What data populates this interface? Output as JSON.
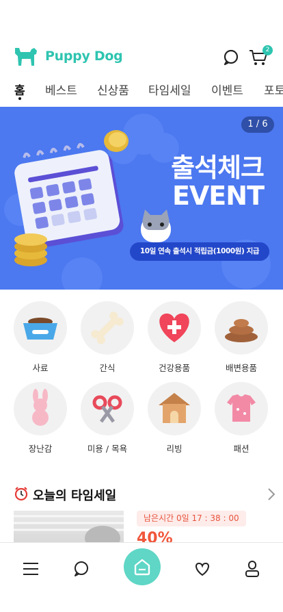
{
  "app": {
    "title": "Puppy Dog"
  },
  "header": {
    "cart_count": "2",
    "icons": [
      "dog-logo-icon",
      "search-icon",
      "cart-icon"
    ]
  },
  "tabs": [
    {
      "label": "홈"
    },
    {
      "label": "베스트"
    },
    {
      "label": "신상품"
    },
    {
      "label": "타임세일"
    },
    {
      "label": "이벤트"
    },
    {
      "label": "포토"
    }
  ],
  "banner": {
    "counter": "1 / 6",
    "title_line1": "출석체크",
    "title_line2": "EVENT",
    "pill": "10일 연속 출석시 적립금(1000원) 지급"
  },
  "categories": [
    {
      "label": "사료",
      "icon": "dog-food-bowl-icon"
    },
    {
      "label": "간식",
      "icon": "bone-icon"
    },
    {
      "label": "건강용품",
      "icon": "health-heart-icon"
    },
    {
      "label": "배변용품",
      "icon": "poop-icon"
    },
    {
      "label": "장난감",
      "icon": "rabbit-toy-icon"
    },
    {
      "label": "미용 / 목욕",
      "icon": "scissors-icon"
    },
    {
      "label": "리빙",
      "icon": "dog-house-icon"
    },
    {
      "label": "패션",
      "icon": "clothes-icon"
    }
  ],
  "timesale": {
    "title": "오늘의 타임세일",
    "timer": "남은시간 0일 17 : 38 : 00",
    "discount": "40%"
  },
  "bottom_nav": {
    "icons": [
      "menu-icon",
      "search-icon",
      "home-icon",
      "heart-icon",
      "user-icon"
    ]
  },
  "colors": {
    "accent": "#2ec4b0",
    "banner_bg": "#4c78f0",
    "sale_red": "#f0573c"
  }
}
